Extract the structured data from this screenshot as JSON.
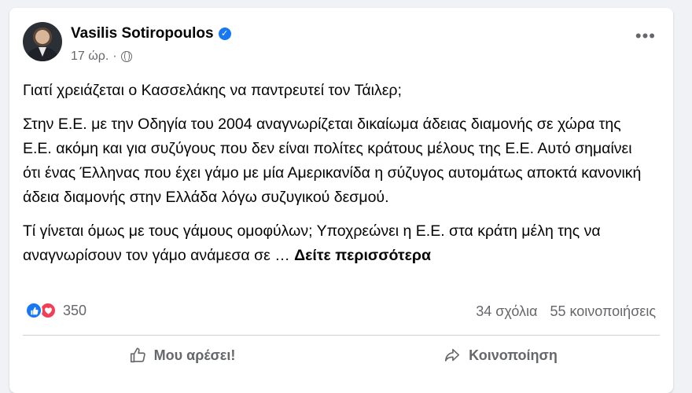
{
  "post": {
    "author": "Vasilis Sotiropoulos",
    "verified_icon": "verified-badge-icon",
    "time": "17 ώρ.",
    "separator": "·",
    "audience_icon": "globe-icon",
    "more_icon": "more-options-icon",
    "more_label": "•••",
    "paragraphs": [
      "Γιατί χρειάζεται ο Κασσελάκης να παντρευτεί τον Τάιλερ;",
      "Στην Ε.Ε. με την Οδηγία του 2004 αναγνωρίζεται δικαίωμα άδειας διαμονής σε χώρα της Ε.Ε. ακόμη και για συζύγους που δεν είναι πολίτες κράτους μέλους της Ε.Ε. Αυτό σημαίνει ότι ένας Έλληνας που έχει γάμο με μία Αμερικανίδα η σύζυγος αυτομάτως αποκτά κανονική άδεια διαμονής στην Ελλάδα λόγω συζυγικού δεσμού.",
      "Τί γίνεται όμως με τους γάμους ομοφύλων; Υποχρεώνει η Ε.Ε. στα κράτη μέλη της να αναγνωρίσουν τον γάμο ανάμεσα σε …"
    ],
    "see_more": "Δείτε περισσότερα"
  },
  "engagement": {
    "reaction_icons": [
      "like-icon",
      "love-icon"
    ],
    "reaction_count": "350",
    "comments": "34 σχόλια",
    "shares": "55 κοινοποιήσεις"
  },
  "actions": {
    "like_label": "Μου αρέσει!",
    "share_label": "Κοινοποίηση"
  },
  "colors": {
    "accent": "#1877f2",
    "love": "#f33e58",
    "secondary_text": "#65676b"
  }
}
